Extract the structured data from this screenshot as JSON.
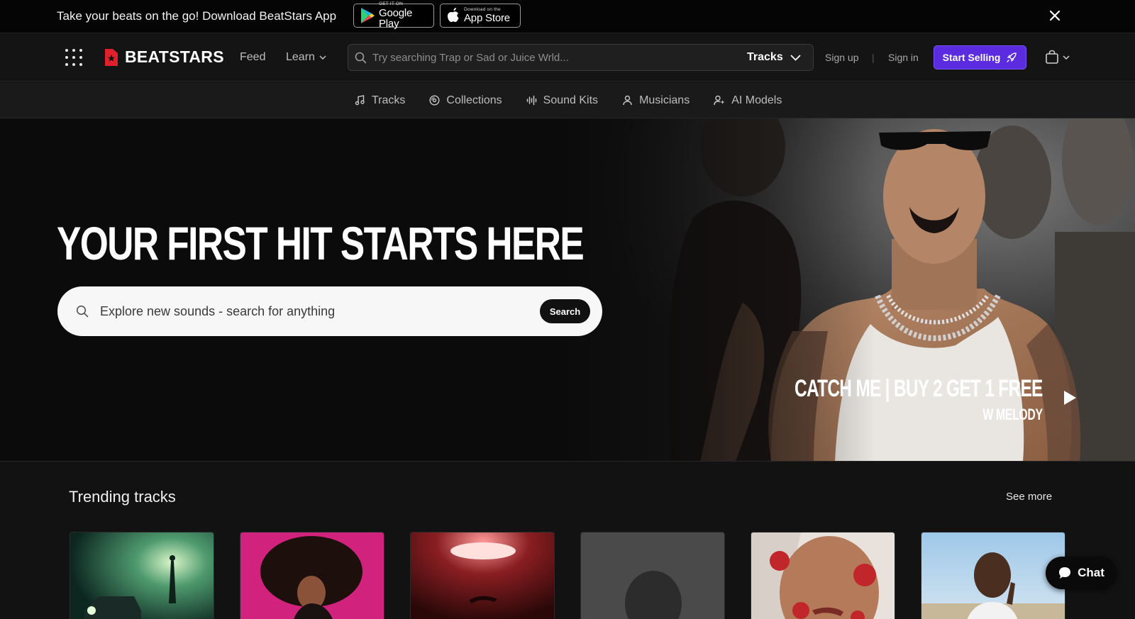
{
  "promo_bar": {
    "text": "Take your beats on the go! Download BeatStars App",
    "google_play": {
      "small": "GET IT ON",
      "big": "Google Play"
    },
    "app_store": {
      "small": "Download on the",
      "big": "App Store"
    }
  },
  "header": {
    "logo_text": "BEATSTARS",
    "feed": "Feed",
    "learn": "Learn",
    "search_placeholder": "Try searching Trap or Sad or Juice Wrld...",
    "search_type": "Tracks",
    "sign_up": "Sign up",
    "separator": "|",
    "sign_in": "Sign in",
    "start_selling": "Start Selling"
  },
  "subnav": {
    "items": [
      {
        "label": "Tracks",
        "icon": "music-note-icon"
      },
      {
        "label": "Collections",
        "icon": "vinyl-icon"
      },
      {
        "label": "Sound Kits",
        "icon": "waveform-icon"
      },
      {
        "label": "Musicians",
        "icon": "person-icon"
      },
      {
        "label": "AI Models",
        "icon": "ai-person-icon"
      }
    ]
  },
  "hero": {
    "title": "YOUR FIRST HIT STARTS HERE",
    "search_placeholder": "Explore new sounds - search for anything",
    "search_button": "Search",
    "promo_line1": "CATCH ME | BUY 2 GET 1 FREE",
    "promo_line2": "W MELODY"
  },
  "trending": {
    "title": "Trending tracks",
    "see_more": "See more"
  },
  "chat": {
    "label": "Chat"
  },
  "colors": {
    "accent_purple": "#5b2be0",
    "brand_red": "#e0202a",
    "background": "#121212"
  }
}
